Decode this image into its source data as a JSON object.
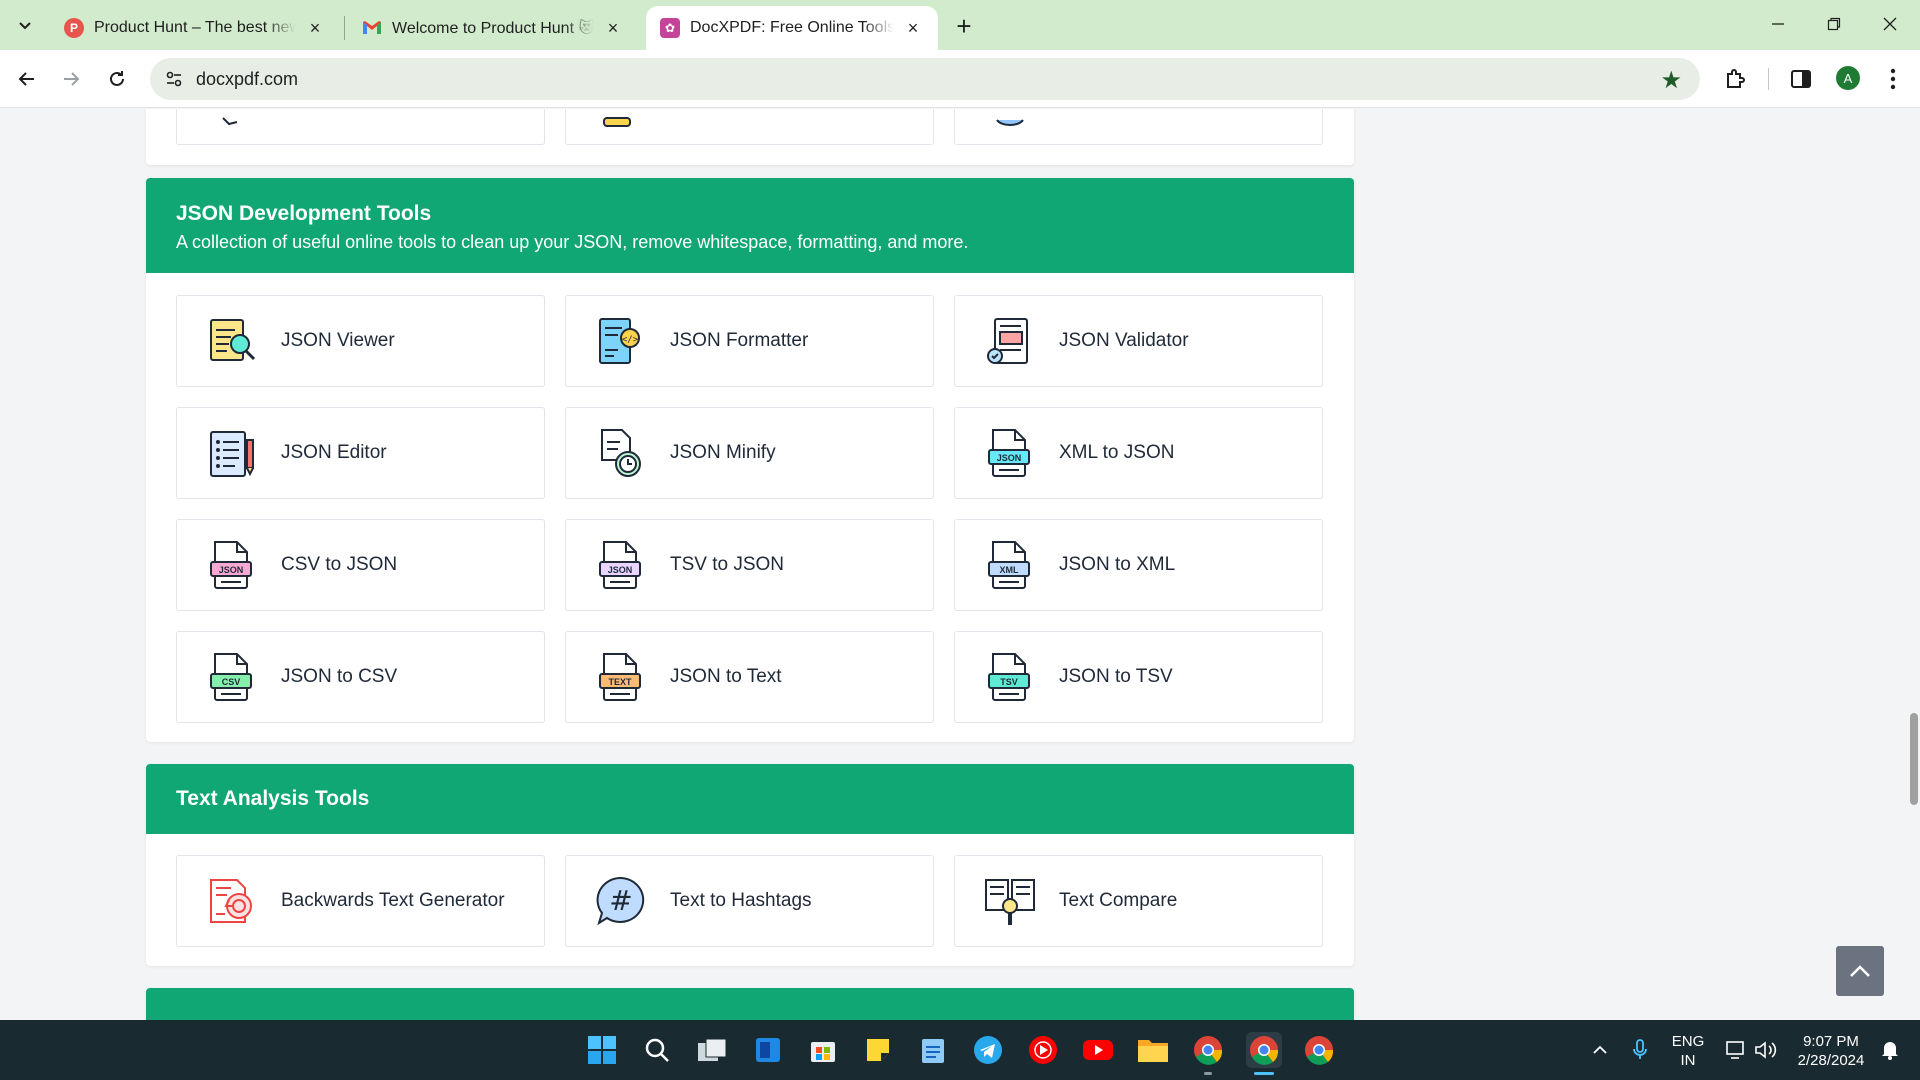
{
  "browser": {
    "tabs": [
      {
        "title": "Product Hunt – The best new products",
        "favicon": "product-hunt-icon",
        "close": "×"
      },
      {
        "title": "Welcome to Product Hunt 😻 - ",
        "favicon": "gmail-icon",
        "close": "×"
      },
      {
        "title": "DocXPDF: Free Online Tools • Free",
        "favicon": "docxpdf-icon",
        "close": "×"
      }
    ],
    "new_tab": "+",
    "address": "docxpdf.com",
    "profile_initial": "A"
  },
  "sections": [
    {
      "title": "JSON Development Tools",
      "subtitle": "A collection of useful online tools to clean up your JSON, remove whitespace, formatting, and more.",
      "tools": [
        {
          "label": "JSON Viewer",
          "icon": "json-viewer-icon"
        },
        {
          "label": "JSON Formatter",
          "icon": "json-formatter-icon"
        },
        {
          "label": "JSON Validator",
          "icon": "json-validator-icon"
        },
        {
          "label": "JSON Editor",
          "icon": "json-editor-icon"
        },
        {
          "label": "JSON Minify",
          "icon": "json-minify-icon"
        },
        {
          "label": "XML to JSON",
          "icon": "xml-to-json-icon",
          "badge": "JSON"
        },
        {
          "label": "CSV to JSON",
          "icon": "csv-to-json-icon",
          "badge": "JSON"
        },
        {
          "label": "TSV to JSON",
          "icon": "tsv-to-json-icon",
          "badge": "JSON"
        },
        {
          "label": "JSON to XML",
          "icon": "json-to-xml-icon",
          "badge": "XML"
        },
        {
          "label": "JSON to CSV",
          "icon": "json-to-csv-icon",
          "badge": "CSV"
        },
        {
          "label": "JSON to Text",
          "icon": "json-to-text-icon",
          "badge": "TEXT"
        },
        {
          "label": "JSON to TSV",
          "icon": "json-to-tsv-icon",
          "badge": "TSV"
        }
      ]
    },
    {
      "title": "Text Analysis Tools",
      "tools": [
        {
          "label": "Backwards Text Generator",
          "icon": "backwards-text-icon"
        },
        {
          "label": "Text to Hashtags",
          "icon": "hashtag-icon"
        },
        {
          "label": "Text Compare",
          "icon": "text-compare-icon"
        }
      ]
    }
  ],
  "taskbar": {
    "lang_top": "ENG",
    "lang_bottom": "IN",
    "time": "9:07 PM",
    "date": "2/28/2024"
  },
  "colors": {
    "section_header": "#10a774",
    "tabbar": "#d3ebcd",
    "taskbar": "#1a2a31"
  }
}
